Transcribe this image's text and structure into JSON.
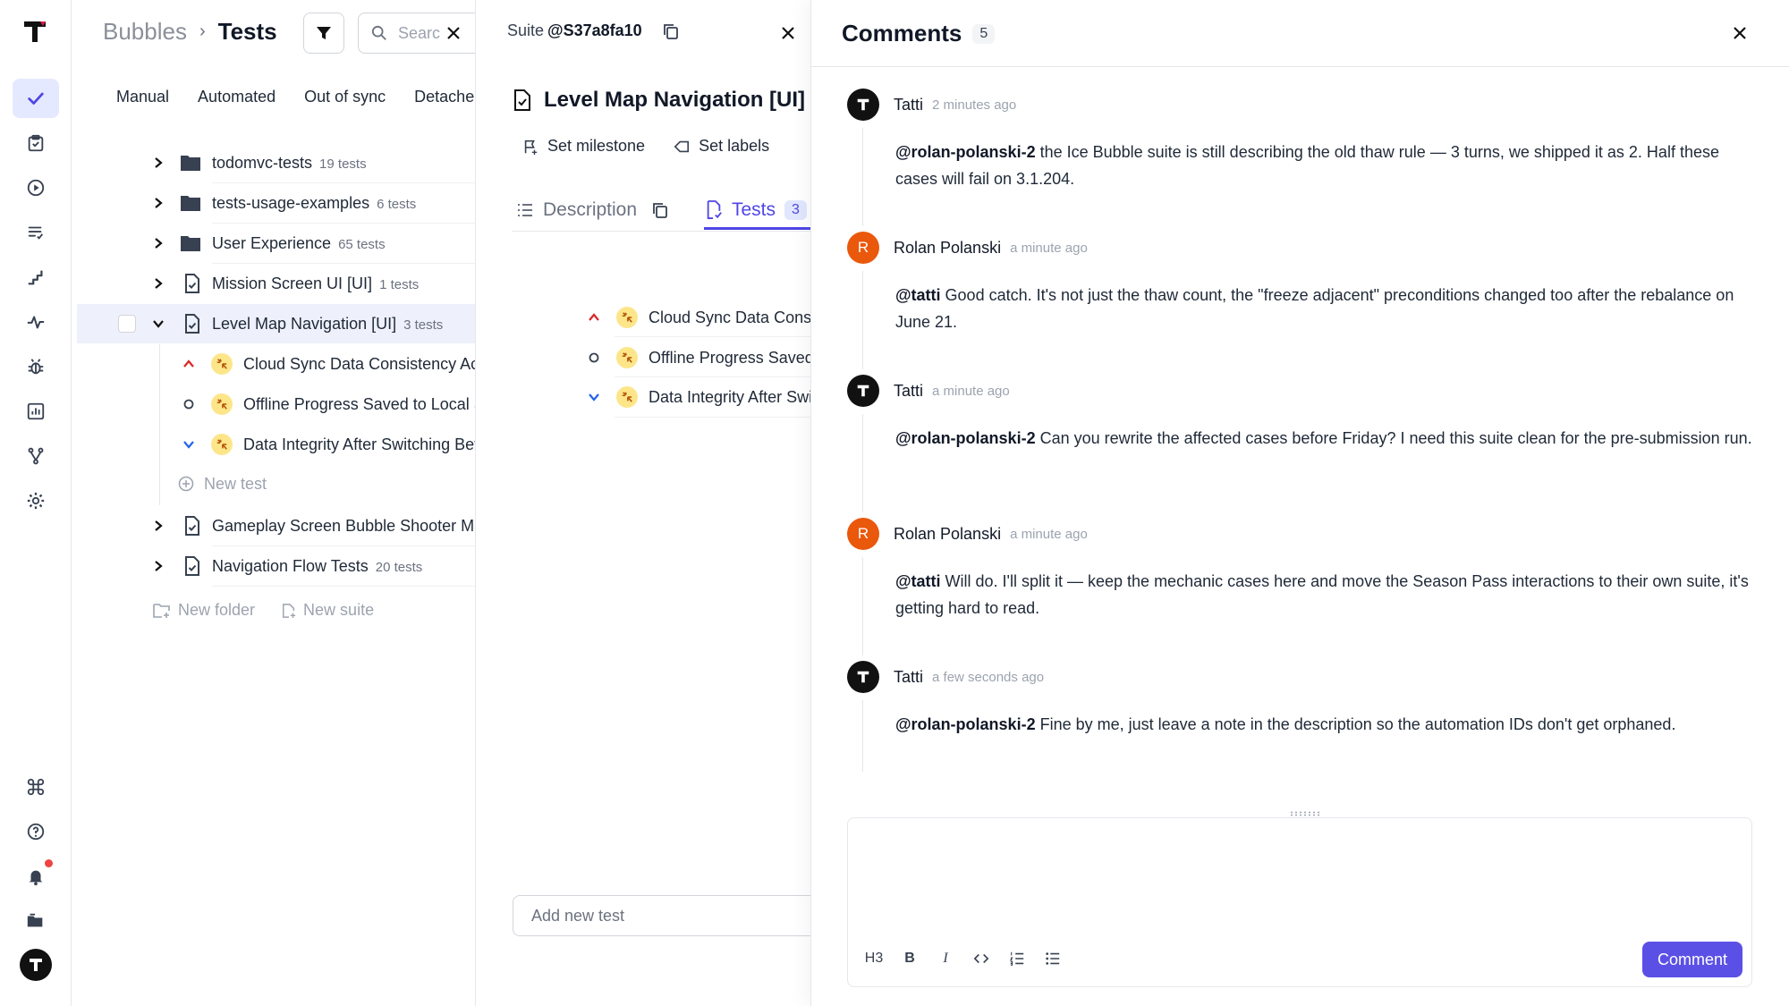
{
  "breadcrumb": {
    "project": "Bubbles",
    "separator": "›",
    "section": "Tests"
  },
  "search": {
    "placeholder": "Search"
  },
  "view_tabs": [
    "Manual",
    "Automated",
    "Out of sync",
    "Detached"
  ],
  "tree": {
    "rows": [
      {
        "name": "todomvc-tests",
        "count": "19 tests",
        "type": "folder"
      },
      {
        "name": "tests-usage-examples",
        "count": "6 tests",
        "type": "folder"
      },
      {
        "name": "User Experience",
        "count": "65 tests",
        "type": "folder"
      },
      {
        "name": "Mission Screen UI [UI]",
        "count": "1 tests",
        "type": "suite"
      },
      {
        "name": "Level Map Navigation [UI]",
        "count": "3 tests",
        "type": "suite"
      }
    ],
    "children": [
      {
        "name": "Cloud Sync Data Consistency Across Devices",
        "priority": "high"
      },
      {
        "name": "Offline Progress Saved to Local Storage",
        "priority": "normal"
      },
      {
        "name": "Data Integrity After Switching Between Devices",
        "priority": "low"
      }
    ],
    "new_test_label": "New test",
    "rows_after": [
      {
        "name": "Gameplay Screen Bubble Shooter Mechanics",
        "count": "",
        "type": "suite"
      },
      {
        "name": "Navigation Flow Tests",
        "count": "20 tests",
        "type": "suite"
      }
    ],
    "new_folder_label": "New folder",
    "new_suite_label": "New suite"
  },
  "suite": {
    "prefix": "Suite",
    "id": "@S37a8fa10",
    "title": "Level Map Navigation [UI]",
    "actions": {
      "milestone": "Set milestone",
      "labels": "Set labels"
    },
    "tabs": {
      "description": "Description",
      "tests": "Tests",
      "tests_count": "3"
    },
    "tests": [
      {
        "name": "Cloud Sync Data Consistency",
        "priority": "high"
      },
      {
        "name": "Offline Progress Saved",
        "priority": "normal"
      },
      {
        "name": "Data Integrity After Switching",
        "priority": "low"
      }
    ],
    "add_placeholder": "Add new test"
  },
  "comments": {
    "title": "Comments",
    "count": "5",
    "items": [
      {
        "author": "Tatti",
        "avatar": "T",
        "time": "2 minutes ago",
        "mention": "@rolan-polanski-2",
        "text": " the Ice Bubble suite is still describing the old thaw rule — 3 turns, we shipped it as 2. Half these cases will fail on 3.1.204."
      },
      {
        "author": "Rolan Polanski",
        "avatar": "R",
        "time": "a minute ago",
        "mention": "@tatti",
        "text": " Good catch. It's not just the thaw count, the \"freeze adjacent\" preconditions changed too after the rebalance on June 21."
      },
      {
        "author": "Tatti",
        "avatar": "T",
        "time": "a minute ago",
        "mention": "@rolan-polanski-2",
        "text": " Can you rewrite the affected cases before Friday? I need this suite clean for the pre-submission run."
      },
      {
        "author": "Rolan Polanski",
        "avatar": "R",
        "time": "a minute ago",
        "mention": "@tatti",
        "text": " Will do. I'll split it — keep the mechanic cases here and move the Season Pass interactions to their own suite, it's getting hard to read."
      },
      {
        "author": "Tatti",
        "avatar": "T",
        "time": "a few seconds ago",
        "mention": "@rolan-polanski-2",
        "text": " Fine by me, just leave a note in the description so the automation IDs don't get orphaned."
      }
    ],
    "toolbar": {
      "heading": "H3",
      "bold": "B",
      "italic": "I"
    },
    "submit_label": "Comment"
  },
  "colors": {
    "accent": "#4f46e5",
    "button": "#5b50e6",
    "high_priority": "#dc2626",
    "low_priority": "#2563eb",
    "orange_avatar": "#ea580c"
  }
}
